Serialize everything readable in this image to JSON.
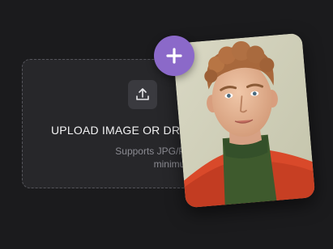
{
  "upload": {
    "title": "UPLOAD IMAGE OR DRA",
    "subtitle_line1": "Supports JPG/PNG formats,",
    "subtitle_line2": "minimum size 300p",
    "icon": "upload-icon"
  },
  "add_button": {
    "icon": "plus-icon"
  },
  "preview": {
    "icon": "portrait-photo"
  },
  "colors": {
    "background": "#1b1b1d",
    "dropzone": "#27272a",
    "accent": "#8b69c9",
    "text_primary": "#f2f2f3",
    "text_secondary": "#8b8b92"
  }
}
